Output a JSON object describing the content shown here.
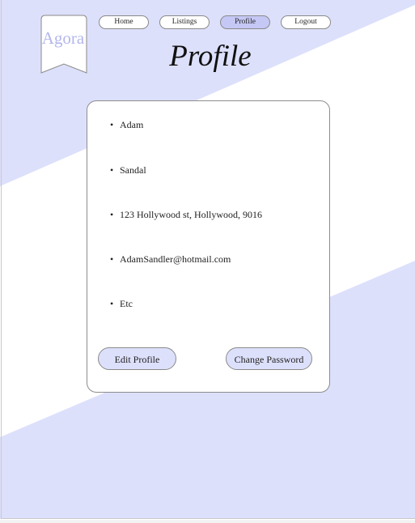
{
  "logo": {
    "text": "Agora"
  },
  "nav": [
    {
      "label": "Home",
      "active": false
    },
    {
      "label": "Listings",
      "active": false
    },
    {
      "label": "Profile",
      "active": true
    },
    {
      "label": "Logout",
      "active": false
    }
  ],
  "page": {
    "title": "Profile"
  },
  "profile": {
    "items": [
      "Adam",
      "Sandal",
      "123 Hollywood st, Hollywood, 9016",
      "AdamSandler@hotmail.com",
      "Etc"
    ]
  },
  "actions": {
    "edit_label": "Edit Profile",
    "change_password_label": "Change Password"
  },
  "colors": {
    "accent": "#dde0fb",
    "active_nav": "#c5c8f5",
    "logo_text": "#b3b6ec"
  }
}
